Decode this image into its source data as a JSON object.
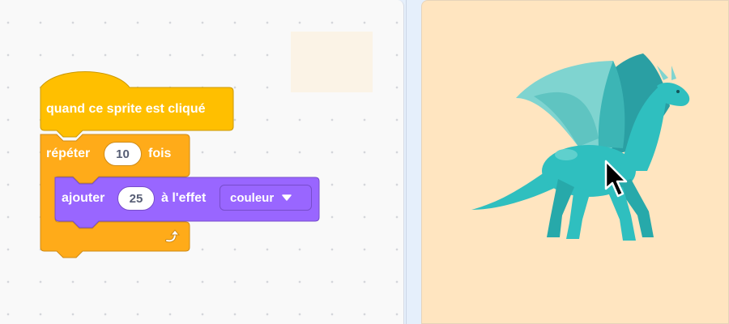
{
  "code": {
    "hat_block": {
      "label": "quand ce sprite est cliqué",
      "color": "#ffbf00"
    },
    "repeat_block": {
      "label_before": "répéter",
      "count": "10",
      "label_after": "fois",
      "color": "#ffab19"
    },
    "looks_block": {
      "label_before": "ajouter",
      "amount": "25",
      "label_middle": "à l'effet",
      "effect": "couleur",
      "color": "#9966ff"
    }
  },
  "stage": {
    "background": "#ffe5c0",
    "sprite": "dragon",
    "sprite_color": "#2fbfbf"
  }
}
